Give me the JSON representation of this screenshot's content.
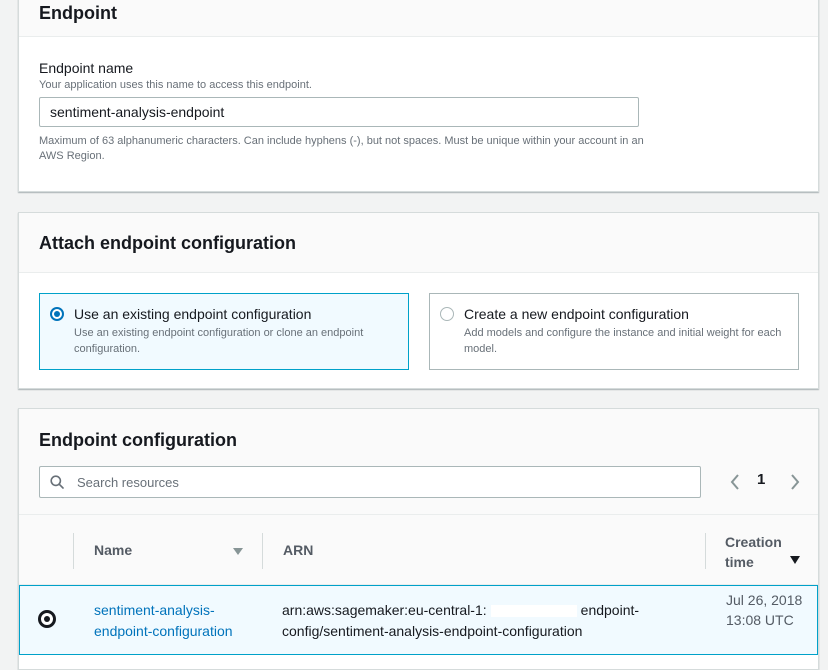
{
  "endpoint_section": {
    "title": "Endpoint",
    "name_label": "Endpoint name",
    "name_description": "Your application uses this name to access this endpoint.",
    "name_value": "sentiment-analysis-endpoint",
    "name_constraint": "Maximum of 63 alphanumeric characters. Can include hyphens (-), but not spaces. Must be unique within your account in an AWS Region."
  },
  "attach_section": {
    "title": "Attach endpoint configuration",
    "options": [
      {
        "title": "Use an existing endpoint configuration",
        "description": "Use an existing endpoint configuration or clone an endpoint configuration.",
        "selected": true
      },
      {
        "title": "Create a new endpoint configuration",
        "description": "Add models and configure the instance and initial weight for each model.",
        "selected": false
      }
    ]
  },
  "config_section": {
    "title": "Endpoint configuration",
    "search_placeholder": "Search resources",
    "pagination": {
      "current_page": "1"
    },
    "columns": {
      "name": "Name",
      "arn": "ARN",
      "creation_time": "Creation time"
    },
    "rows": [
      {
        "selected": true,
        "name": "sentiment-analysis-endpoint-configuration",
        "arn_prefix": "arn:aws:sagemaker:eu-central-1:",
        "arn_suffix": "endpoint-config/sentiment-analysis-endpoint-configuration",
        "creation_time": "Jul 26, 2018 13:08 UTC"
      }
    ]
  },
  "colors": {
    "accent": "#0073bb",
    "selected_border": "#00a1c9",
    "selected_bg": "#f1faff",
    "page_bg": "#f2f3f3"
  },
  "icons": [
    "search-icon",
    "chevron-left-icon",
    "chevron-right-icon",
    "caret-down-icon",
    "sort-descending-icon"
  ]
}
